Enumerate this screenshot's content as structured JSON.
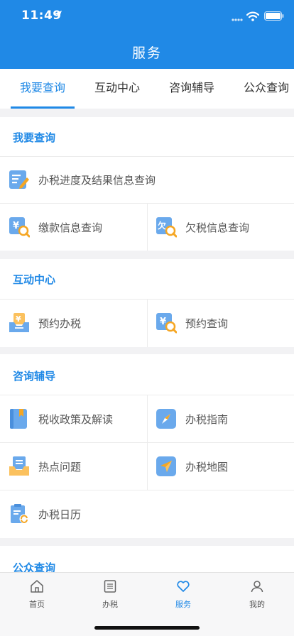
{
  "status": {
    "time": "11:49"
  },
  "header": {
    "title": "服务"
  },
  "tabs": [
    "我要查询",
    "互动中心",
    "咨询辅导",
    "公众查询"
  ],
  "sections": {
    "query": {
      "title": "我要查询",
      "items": [
        "办税进度及结果信息查询",
        "缴款信息查询",
        "欠税信息查询"
      ]
    },
    "interact": {
      "title": "互动中心",
      "items": [
        "预约办税",
        "预约查询"
      ]
    },
    "consult": {
      "title": "咨询辅导",
      "items": [
        "税收政策及解读",
        "办税指南",
        "热点问题",
        "办税地图",
        "办税日历"
      ]
    },
    "public": {
      "title": "公众查询"
    }
  },
  "tabbar": {
    "items": [
      "首页",
      "办税",
      "服务",
      "我的"
    ],
    "active": "服务"
  },
  "colors": {
    "accent": "#2089e6",
    "header_bg": "#2089e6",
    "page_bg": "#f2f2f4"
  }
}
